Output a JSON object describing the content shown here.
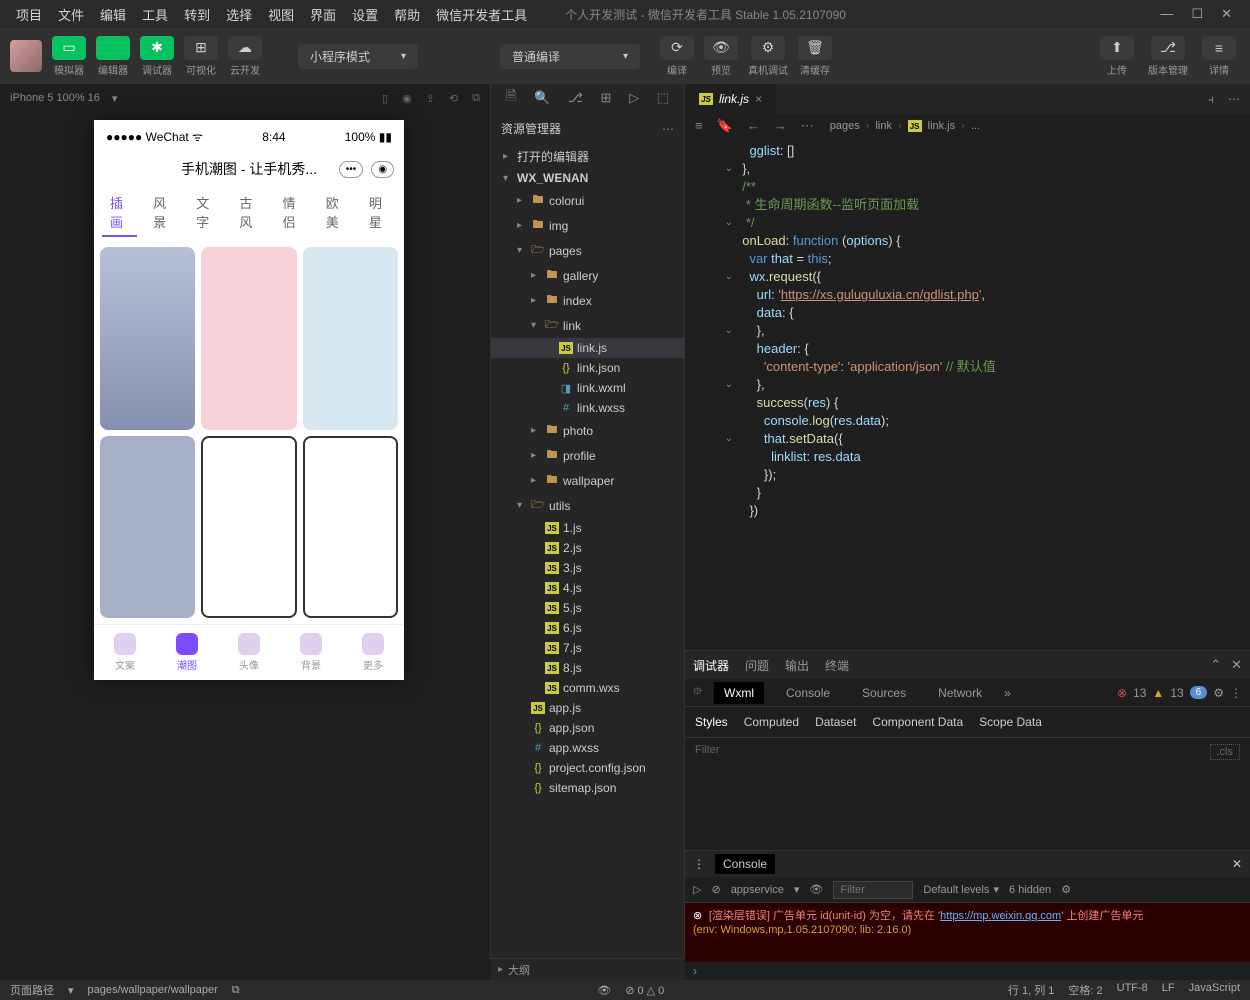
{
  "menubar": {
    "items": [
      "项目",
      "文件",
      "编辑",
      "工具",
      "转到",
      "选择",
      "视图",
      "界面",
      "设置",
      "帮助",
      "微信开发者工具"
    ],
    "title": "个人开发测试 - 微信开发者工具 Stable 1.05.2107090"
  },
  "toolbar": {
    "groups": [
      {
        "icon": "▭",
        "label": "模拟器",
        "class": "green"
      },
      {
        "icon": "</>",
        "label": "编辑器",
        "class": "green"
      },
      {
        "icon": "✱",
        "label": "调试器",
        "class": "green"
      },
      {
        "icon": "⊞",
        "label": "可视化",
        "class": "dark"
      },
      {
        "icon": "☁",
        "label": "云开发",
        "class": "dark"
      }
    ],
    "mode_dropdown": "小程序模式",
    "compile_dropdown": "普通编译",
    "actions": [
      {
        "icon": "⟳",
        "label": "编译"
      },
      {
        "icon": "👁",
        "label": "预览"
      },
      {
        "icon": "⚙",
        "label": "真机调试"
      },
      {
        "icon": "🗑",
        "label": "清缓存"
      }
    ],
    "right": [
      {
        "icon": "⬆",
        "label": "上传"
      },
      {
        "icon": "⎇",
        "label": "版本管理"
      },
      {
        "icon": "≡",
        "label": "详情"
      }
    ]
  },
  "simulator": {
    "device": "iPhone 5 100% 16",
    "wechat": "WeChat",
    "time": "8:44",
    "battery": "100%",
    "page_title": "手机潮图 - 让手机秀...",
    "tabs": [
      "插画",
      "风景",
      "文字",
      "古风",
      "情侣",
      "欧美",
      "明星"
    ],
    "nav": [
      {
        "l": "文案"
      },
      {
        "l": "潮图"
      },
      {
        "l": "头像"
      },
      {
        "l": "背景"
      },
      {
        "l": "更多"
      }
    ]
  },
  "explorer": {
    "title": "资源管理器",
    "sections": [
      "打开的编辑器",
      "WX_WENAN"
    ],
    "tree": [
      {
        "n": "colorui",
        "k": "folder",
        "lvl": 2
      },
      {
        "n": "img",
        "k": "folder",
        "lvl": 2
      },
      {
        "n": "pages",
        "k": "folder-open",
        "lvl": 2,
        "exp": true
      },
      {
        "n": "gallery",
        "k": "folder",
        "lvl": 3
      },
      {
        "n": "index",
        "k": "folder",
        "lvl": 3
      },
      {
        "n": "link",
        "k": "folder-open",
        "lvl": 3,
        "exp": true
      },
      {
        "n": "link.js",
        "k": "js",
        "lvl": 4,
        "active": true
      },
      {
        "n": "link.json",
        "k": "json",
        "lvl": 4
      },
      {
        "n": "link.wxml",
        "k": "wxml",
        "lvl": 4
      },
      {
        "n": "link.wxss",
        "k": "css",
        "lvl": 4
      },
      {
        "n": "photo",
        "k": "folder",
        "lvl": 3
      },
      {
        "n": "profile",
        "k": "folder",
        "lvl": 3
      },
      {
        "n": "wallpaper",
        "k": "folder",
        "lvl": 3
      },
      {
        "n": "utils",
        "k": "folder-open",
        "lvl": 2,
        "exp": true
      },
      {
        "n": "1.js",
        "k": "js",
        "lvl": 3
      },
      {
        "n": "2.js",
        "k": "js",
        "lvl": 3
      },
      {
        "n": "3.js",
        "k": "js",
        "lvl": 3
      },
      {
        "n": "4.js",
        "k": "js",
        "lvl": 3
      },
      {
        "n": "5.js",
        "k": "js",
        "lvl": 3
      },
      {
        "n": "6.js",
        "k": "js",
        "lvl": 3
      },
      {
        "n": "7.js",
        "k": "js",
        "lvl": 3
      },
      {
        "n": "8.js",
        "k": "js",
        "lvl": 3
      },
      {
        "n": "comm.wxs",
        "k": "js",
        "lvl": 3
      },
      {
        "n": "app.js",
        "k": "js",
        "lvl": 2
      },
      {
        "n": "app.json",
        "k": "json",
        "lvl": 2
      },
      {
        "n": "app.wxss",
        "k": "css",
        "lvl": 2
      },
      {
        "n": "project.config.json",
        "k": "json",
        "lvl": 2
      },
      {
        "n": "sitemap.json",
        "k": "json",
        "lvl": 2
      }
    ],
    "outline": "大纲"
  },
  "editor": {
    "tab": "link.js",
    "breadcrumb": [
      "pages",
      "link",
      "link.js",
      "..."
    ],
    "code_lines": [
      {
        "html": "    <span class='c-lblue'>gglist</span><span class='c-gray'>: []</span>"
      },
      {
        "html": "  <span class='c-gray'>},</span>",
        "fold": true
      },
      {
        "html": ""
      },
      {
        "html": "  <span class='c-green'>/**</span>"
      },
      {
        "html": "  <span class='c-green'> * 生命周期函数--监听页面加载</span>"
      },
      {
        "html": "  <span class='c-green'> */</span>",
        "fold": true
      },
      {
        "html": "  <span class='c-yellow'>onLoad</span><span class='c-gray'>: </span><span class='c-blue'>function</span> <span class='c-gray'>(</span><span class='c-lblue'>options</span><span class='c-gray'>) {</span>"
      },
      {
        "html": "    <span class='c-blue'>var</span> <span class='c-lblue'>that</span> <span class='c-gray'>= </span><span class='c-blue'>this</span><span class='c-gray'>;</span>"
      },
      {
        "html": "    <span class='c-lblue'>wx</span><span class='c-gray'>.</span><span class='c-yellow'>request</span><span class='c-gray'>({</span>",
        "fold": true
      },
      {
        "html": "      <span class='c-lblue'>url</span><span class='c-gray'>: </span><span class='c-orange'>'</span><span class='url-link'>https://xs.guluguluxia.cn/gdlist.php</span><span class='c-orange'>'</span><span class='c-gray'>,</span>"
      },
      {
        "html": "      <span class='c-lblue'>data</span><span class='c-gray'>: {</span>"
      },
      {
        "html": "      <span class='c-gray'>},</span>",
        "fold": true
      },
      {
        "html": "      <span class='c-lblue'>header</span><span class='c-gray'>: {</span>"
      },
      {
        "html": "        <span class='c-orange'>'content-type'</span><span class='c-gray'>: </span><span class='c-orange'>'application/json'</span> <span class='c-green'>// 默认值</span>"
      },
      {
        "html": "      <span class='c-gray'>},</span>",
        "fold": true
      },
      {
        "html": "      <span class='c-yellow'>success</span><span class='c-gray'>(</span><span class='c-lblue'>res</span><span class='c-gray'>) {</span>"
      },
      {
        "html": "        <span class='c-lblue'>console</span><span class='c-gray'>.</span><span class='c-yellow'>log</span><span class='c-gray'>(</span><span class='c-lblue'>res</span><span class='c-gray'>.</span><span class='c-lblue'>data</span><span class='c-gray'>);</span>"
      },
      {
        "html": "        <span class='c-lblue'>that</span><span class='c-gray'>.</span><span class='c-yellow'>setData</span><span class='c-gray'>({</span>",
        "fold": true
      },
      {
        "html": "          <span class='c-lblue'>linklist</span><span class='c-gray'>: </span><span class='c-lblue'>res</span><span class='c-gray'>.</span><span class='c-lblue'>data</span>"
      },
      {
        "html": "        <span class='c-gray'>});</span>"
      },
      {
        "html": "      <span class='c-gray'>}</span>"
      },
      {
        "html": "    <span class='c-gray'>})</span>"
      }
    ]
  },
  "debugger": {
    "top_tabs": [
      "调试器",
      "问题",
      "输出",
      "终端"
    ],
    "inspect_tabs": [
      "Wxml",
      "Console",
      "Sources",
      "Network"
    ],
    "badges": {
      "err": "13",
      "warn": "13",
      "info": "6"
    },
    "styles_tabs": [
      "Styles",
      "Computed",
      "Dataset",
      "Component Data",
      "Scope Data"
    ],
    "filter": "Filter",
    "cls": ".cls",
    "console": {
      "tab": "Console",
      "context": "appservice",
      "filter": "Filter",
      "levels": "Default levels",
      "hidden": "6 hidden",
      "msg1": "[渲染层错误] 广告单元 id(unit-id) 为空，请先在 '",
      "link": "https://mp.weixin.qq.com",
      "msg2": "' 上创建广告单元",
      "env": "(env: Windows,mp,1.05.2107090; lib: 2.16.0)"
    }
  },
  "statusbar": {
    "path_label": "页面路径",
    "path": "pages/wallpaper/wallpaper",
    "msgs": "⊘ 0 △ 0",
    "cursor": "行 1, 列 1",
    "spaces": "空格: 2",
    "encoding": "UTF-8",
    "eol": "LF",
    "lang": "JavaScript"
  }
}
